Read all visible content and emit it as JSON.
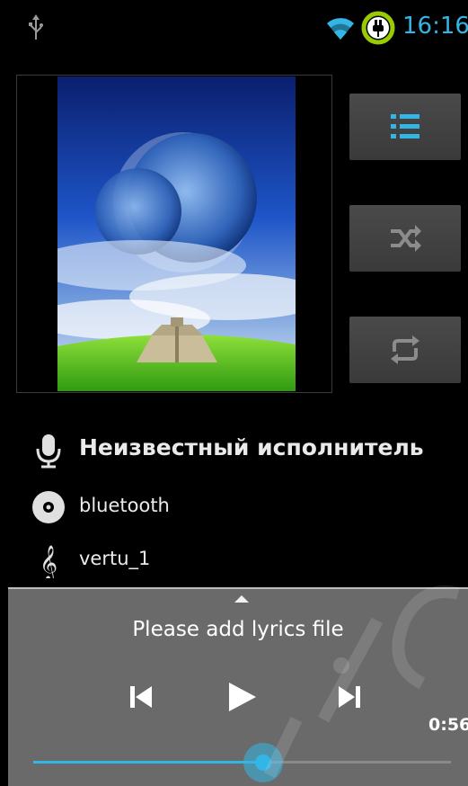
{
  "status_bar": {
    "time": "16:16",
    "icons": [
      "usb-icon",
      "wifi-icon",
      "battery-charging-icon"
    ],
    "accent_color": "#33b5e5"
  },
  "side_buttons": [
    {
      "name": "playlist-button",
      "icon": "playlist-icon",
      "active": true
    },
    {
      "name": "shuffle-button",
      "icon": "shuffle-icon",
      "active": false
    },
    {
      "name": "repeat-button",
      "icon": "repeat-icon",
      "active": false
    }
  ],
  "track": {
    "artist": "Неизвестный исполнитель",
    "album": "bluetooth",
    "title": "vertu_1"
  },
  "player": {
    "lyrics_text": "Please add lyrics file",
    "elapsed": "0:56",
    "progress": 0.55
  }
}
